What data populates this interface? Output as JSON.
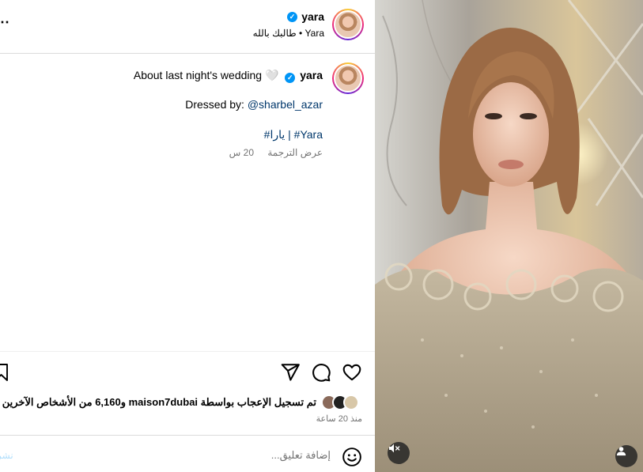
{
  "header": {
    "username": "yara",
    "subtitle": "طالبك بالله • Yara"
  },
  "caption": {
    "username": "yara",
    "text": "About last night's wedding 🤍",
    "dressed_by_label": "Dressed by:",
    "dressed_by_mention": "@sharbel_azar",
    "hashtags": "#يارا | #Yara",
    "age": "20 س",
    "translate": "عرض الترجمة"
  },
  "likes": {
    "text": "تم تسجيل الإعجاب بواسطة maison7dubai و6,160 من الأشخاص الآخرين",
    "time": "منذ 20 ساعة"
  },
  "comment": {
    "placeholder": "إضافة تعليق...",
    "post_label": "نشر"
  },
  "icons": {
    "more": "more-horizontal-icon",
    "like": "heart-icon",
    "comment": "comment-bubble-icon",
    "share": "paper-plane-icon",
    "save": "bookmark-icon",
    "emoji": "emoji-smiley-icon",
    "mute": "speaker-muted-icon",
    "tag": "user-tag-icon",
    "verified": "verified-badge-icon"
  },
  "colors": {
    "link": "#00376b",
    "verified": "#0095f6",
    "secondary_text": "#737373",
    "divider": "#dbdbdb"
  }
}
